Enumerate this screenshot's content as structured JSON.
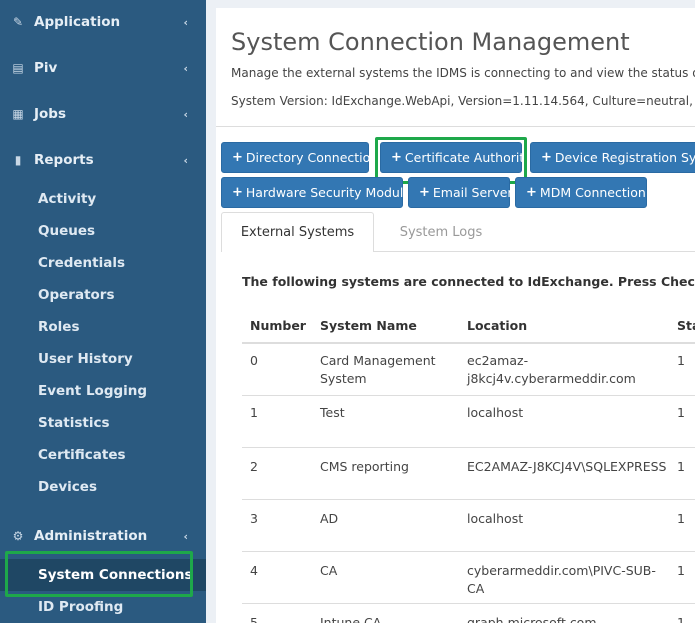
{
  "sidebar": {
    "items": [
      {
        "label": "Application",
        "icon": "edit-icon"
      },
      {
        "label": "Piv",
        "icon": "id-card-icon"
      },
      {
        "label": "Jobs",
        "icon": "calendar-icon"
      },
      {
        "label": "Reports",
        "icon": "bar-chart-icon"
      }
    ],
    "reports_sub": [
      "Activity",
      "Queues",
      "Credentials",
      "Operators",
      "Roles",
      "User History",
      "Event Logging",
      "Statistics",
      "Certificates",
      "Devices"
    ],
    "administration": {
      "label": "Administration",
      "icon": "gear-icon"
    },
    "admin_sub": [
      "System Connections",
      "ID Proofing"
    ]
  },
  "page": {
    "title": "System Connection Management",
    "description": "Manage the external systems the IDMS is connecting to and view the status o",
    "version": "System Version: IdExchange.WebApi, Version=1.11.14.564, Culture=neutral, P"
  },
  "buttons": {
    "row1": [
      "Directory Connection",
      "Certificate Authority",
      "Device Registration Syster"
    ],
    "row2": [
      "Hardware Security Module",
      "Email Server",
      "MDM Connection"
    ],
    "plus": "+"
  },
  "tabs": [
    "External Systems",
    "System Logs"
  ],
  "intro": "The following systems are connected to IdExchange. Press Check to ob",
  "table": {
    "headers": [
      "Number",
      "System Name",
      "Location",
      "Sta"
    ],
    "rows": [
      {
        "number": "0",
        "name": [
          "Card Management",
          "System"
        ],
        "location": [
          "ec2amaz-",
          "j8kcj4v.cyberarmeddir.com"
        ],
        "status": "1"
      },
      {
        "number": "1",
        "name": [
          "Test"
        ],
        "location": [
          "localhost"
        ],
        "status": "1"
      },
      {
        "number": "2",
        "name": [
          "CMS reporting"
        ],
        "location": [
          "EC2AMAZ-J8KCJ4V\\SQLEXPRESS"
        ],
        "status": "1"
      },
      {
        "number": "3",
        "name": [
          "AD"
        ],
        "location": [
          "localhost"
        ],
        "status": "1"
      },
      {
        "number": "4",
        "name": [
          "CA"
        ],
        "location": [
          "cyberarmeddir.com\\PIVC-SUB-",
          "CA"
        ],
        "status": "1"
      },
      {
        "number": "5",
        "name": [
          "Intune CA"
        ],
        "location": [
          "graph.microsoft.com"
        ],
        "status": "1"
      }
    ]
  },
  "colors": {
    "sidebar": "#2b5a80",
    "primary": "#3377b3",
    "highlight": "#1ea84a"
  }
}
